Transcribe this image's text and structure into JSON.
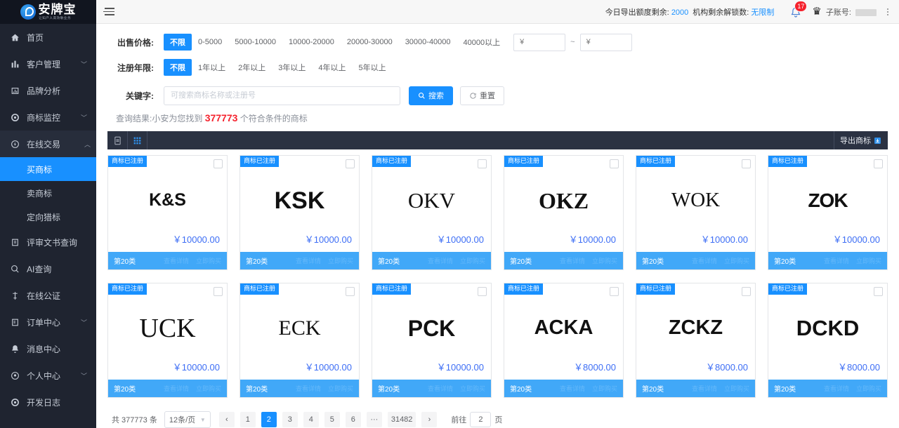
{
  "sidebar": {
    "logo": {
      "title": "安牌宝",
      "tagline": "让知产人高效敏业务"
    },
    "items": [
      {
        "label": "首页",
        "icon": "home-icon",
        "arrow": false
      },
      {
        "label": "客户管理",
        "icon": "chart-bar-icon",
        "arrow": true
      },
      {
        "label": "品牌分析",
        "icon": "analytics-icon",
        "arrow": false
      },
      {
        "label": "商标监控",
        "icon": "radar-icon",
        "arrow": true
      },
      {
        "label": "在线交易",
        "icon": "transaction-icon",
        "arrow": true,
        "expanded": true
      }
    ],
    "sub_items": [
      {
        "label": "买商标",
        "active": true
      },
      {
        "label": "卖商标",
        "active": false
      },
      {
        "label": "定向猎标",
        "active": false
      }
    ],
    "items_after": [
      {
        "label": "评审文书查询",
        "icon": "document-search-icon",
        "arrow": false
      },
      {
        "label": "AI查询",
        "icon": "ai-search-icon",
        "arrow": false
      },
      {
        "label": "在线公证",
        "icon": "notary-icon",
        "arrow": false
      },
      {
        "label": "订单中心",
        "icon": "order-icon",
        "arrow": true
      },
      {
        "label": "消息中心",
        "icon": "bell-icon",
        "arrow": false
      },
      {
        "label": "个人中心",
        "icon": "user-circle-icon",
        "arrow": true
      },
      {
        "label": "开发日志",
        "icon": "dev-log-icon",
        "arrow": false
      }
    ]
  },
  "header": {
    "quota_label": "今日导出额度剩余:",
    "quota_value": "2000",
    "unlock_label": "机构剩余解锁数:",
    "unlock_value": "无限制",
    "notification_count": "17",
    "subaccount_label": "子账号:"
  },
  "filters": {
    "price": {
      "label": "出售价格:",
      "options": [
        "不限",
        "0-5000",
        "5000-10000",
        "10000-20000",
        "20000-30000",
        "30000-40000",
        "40000以上"
      ],
      "active_index": 0,
      "min_placeholder": "¥",
      "max_placeholder": "¥",
      "min_value": "",
      "max_value": "",
      "separator": "~"
    },
    "years": {
      "label": "注册年限:",
      "options": [
        "不限",
        "1年以上",
        "2年以上",
        "3年以上",
        "4年以上",
        "5年以上"
      ],
      "active_index": 0
    },
    "keyword": {
      "label": "关键字:",
      "placeholder": "可搜索商标名称或注册号",
      "value": "",
      "search_label": "搜索",
      "reset_label": "重置"
    }
  },
  "result": {
    "prefix": "查询结果:小安为您找到",
    "count": "377773",
    "suffix": "个符合条件的商标"
  },
  "toolbar": {
    "list_view_icon": "list-view-icon",
    "grid_view_icon": "grid-view-icon",
    "export_label": "导出商标",
    "export_icon": "export-icon"
  },
  "cards": [
    {
      "tag": "商标已注册",
      "name": "K&S",
      "style": "lg-sans-bold",
      "size": 25,
      "price": "￥10000.00",
      "class": "第20类",
      "actions": [
        "查看详情",
        "立即购买"
      ]
    },
    {
      "tag": "商标已注册",
      "name": "KSK",
      "style": "lg-sans-bold",
      "size": 34,
      "price": "￥10000.00",
      "class": "第20类",
      "actions": [
        "查看详情",
        "立即购买"
      ]
    },
    {
      "tag": "商标已注册",
      "name": "OKV",
      "style": "lg-serif",
      "size": 31,
      "price": "￥10000.00",
      "class": "第20类",
      "actions": [
        "查看详情",
        "立即购买"
      ]
    },
    {
      "tag": "商标已注册",
      "name": "OKZ",
      "style": "lg-serif-bold",
      "size": 32,
      "price": "￥10000.00",
      "class": "第20类",
      "actions": [
        "查看详情",
        "立即购买"
      ]
    },
    {
      "tag": "商标已注册",
      "name": "WOK",
      "style": "lg-serif",
      "size": 29,
      "price": "￥10000.00",
      "class": "第20类",
      "actions": [
        "查看详情",
        "立即购买"
      ]
    },
    {
      "tag": "商标已注册",
      "name": "ZOK",
      "style": "lg-stencil",
      "size": 28,
      "price": "￥10000.00",
      "class": "第20类",
      "actions": [
        "查看详情",
        "立即购买"
      ]
    },
    {
      "tag": "商标已注册",
      "name": "UCK",
      "style": "lg-serif",
      "size": 38,
      "price": "￥10000.00",
      "class": "第20类",
      "actions": [
        "查看详情",
        "立即购买"
      ]
    },
    {
      "tag": "商标已注册",
      "name": "ECK",
      "style": "lg-serif",
      "size": 30,
      "price": "￥10000.00",
      "class": "第20类",
      "actions": [
        "查看详情",
        "立即购买"
      ]
    },
    {
      "tag": "商标已注册",
      "name": "PCK",
      "style": "lg-sans-bold",
      "size": 32,
      "price": "￥10000.00",
      "class": "第20类",
      "actions": [
        "查看详情",
        "立即购买"
      ]
    },
    {
      "tag": "商标已注册",
      "name": "ACKA",
      "style": "lg-sans-bold",
      "size": 29,
      "price": "￥8000.00",
      "class": "第20类",
      "actions": [
        "查看详情",
        "立即购买"
      ]
    },
    {
      "tag": "商标已注册",
      "name": "ZCKZ",
      "style": "lg-sans-bold",
      "size": 29,
      "price": "￥8000.00",
      "class": "第20类",
      "actions": [
        "查看详情",
        "立即购买"
      ]
    },
    {
      "tag": "商标已注册",
      "name": "DCKD",
      "style": "lg-sans-bold",
      "size": 31,
      "price": "￥8000.00",
      "class": "第20类",
      "actions": [
        "查看详情",
        "立即购买"
      ]
    }
  ],
  "pagination": {
    "total_text": "共 377773 条",
    "page_size": "12条/页",
    "prev": "‹",
    "next": "›",
    "pages": [
      "1",
      "2",
      "3",
      "4",
      "5",
      "6",
      "···",
      "31482"
    ],
    "current": "2",
    "jump_prefix": "前往",
    "jump_value": "2",
    "jump_suffix": "页"
  }
}
